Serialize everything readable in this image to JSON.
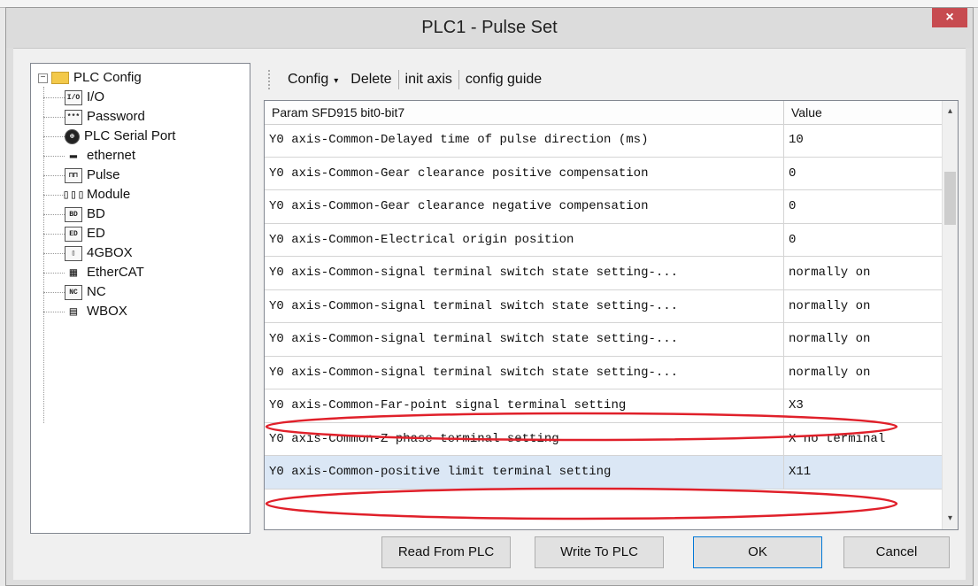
{
  "window": {
    "title": "PLC1 - Pulse  Set",
    "close_glyph": "×"
  },
  "tree": {
    "root": {
      "label": "PLC Config",
      "expander": "−"
    },
    "items": [
      {
        "icon": "I/O",
        "label": "I/O"
      },
      {
        "icon": "***",
        "label": "Password"
      },
      {
        "icon": "⊕",
        "label": "PLC Serial Port"
      },
      {
        "icon": "▬",
        "label": "ethernet"
      },
      {
        "icon": "⊓⊓",
        "label": "Pulse"
      },
      {
        "icon": "▯▯▯",
        "label": "Module"
      },
      {
        "icon": "BD",
        "label": "BD"
      },
      {
        "icon": "ED",
        "label": "ED"
      },
      {
        "icon": "▯",
        "label": "4GBOX"
      },
      {
        "icon": "▦",
        "label": "EtherCAT"
      },
      {
        "icon": "NC",
        "label": "NC"
      },
      {
        "icon": "▤",
        "label": "WBOX"
      }
    ]
  },
  "toolbar": {
    "config_label": "Config",
    "config_caret": "▾",
    "delete_label": "Delete",
    "init_axis_label": "init axis",
    "config_guide_label": "config guide"
  },
  "grid": {
    "headers": {
      "param": "Param SFD915 bit0-bit7",
      "value": "Value"
    },
    "rows": [
      {
        "param": "Y0 axis-Common-Delayed time of pulse direction (ms)",
        "value": "10"
      },
      {
        "param": "Y0 axis-Common-Gear clearance positive compensation",
        "value": "0"
      },
      {
        "param": "Y0 axis-Common-Gear clearance negative compensation",
        "value": "0"
      },
      {
        "param": "Y0 axis-Common-Electrical origin position",
        "value": "0"
      },
      {
        "param": "Y0 axis-Common-signal terminal switch state setting-...",
        "value": "normally on"
      },
      {
        "param": "Y0 axis-Common-signal terminal switch state setting-...",
        "value": "normally on"
      },
      {
        "param": "Y0 axis-Common-signal terminal switch state setting-...",
        "value": "normally on"
      },
      {
        "param": "Y0 axis-Common-signal terminal switch state setting-...",
        "value": "normally on"
      },
      {
        "param": "Y0 axis-Common-Far-point signal terminal setting",
        "value": "X3"
      },
      {
        "param": "Y0 axis-Common-Z phase terminal setting",
        "value": "X no terminal"
      },
      {
        "param": "Y0 axis-Common-positive limit terminal setting",
        "value": "X11"
      }
    ],
    "scroll_up": "▴",
    "scroll_down": "▾",
    "annotation_color": "#e0202a",
    "selected_row_color": "#dbe7f5"
  },
  "buttons": {
    "read": "Read From PLC",
    "write": "Write To PLC",
    "ok": "OK",
    "cancel": "Cancel"
  }
}
